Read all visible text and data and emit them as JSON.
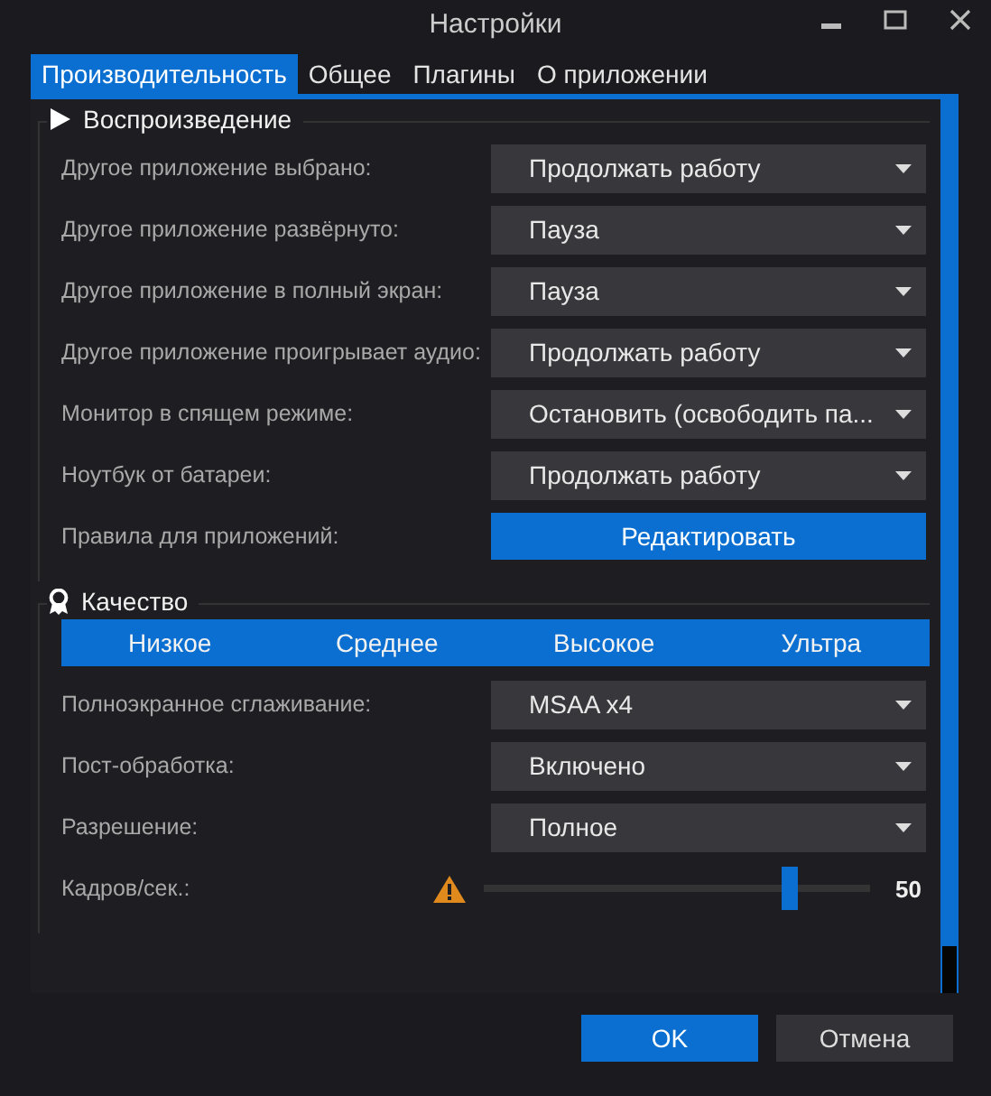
{
  "window": {
    "title": "Настройки"
  },
  "tabs": [
    {
      "label": "Производительность",
      "selected": true
    },
    {
      "label": "Общее",
      "selected": false
    },
    {
      "label": "Плагины",
      "selected": false
    },
    {
      "label": "О приложении",
      "selected": false
    }
  ],
  "sections": [
    {
      "title": "Воспроизведение",
      "rows": [
        {
          "kind": "dropdown",
          "label": "Другое приложение выбрано:",
          "value": "Продолжать работу"
        },
        {
          "kind": "dropdown",
          "label": "Другое приложение развёрнуто:",
          "value": "Пауза"
        },
        {
          "kind": "dropdown",
          "label": "Другое приложение в полный экран:",
          "value": "Пауза"
        },
        {
          "kind": "dropdown",
          "label": "Другое приложение проигрывает аудио:",
          "value": "Продолжать работу"
        },
        {
          "kind": "dropdown",
          "label": "Монитор в спящем режиме:",
          "value": "Остановить (освободить па..."
        },
        {
          "kind": "dropdown",
          "label": "Ноутбук от батареи:",
          "value": "Продолжать работу"
        },
        {
          "kind": "button",
          "label": "Правила для приложений:",
          "value": "Редактировать"
        }
      ]
    },
    {
      "title": "Качество",
      "presets": [
        {
          "label": "Низкое",
          "selected": false
        },
        {
          "label": "Среднее",
          "selected": false
        },
        {
          "label": "Высокое",
          "selected": false
        },
        {
          "label": "Ультра",
          "selected": false
        }
      ],
      "rows": [
        {
          "kind": "dropdown",
          "label": "Полноэкранное сглаживание:",
          "value": "MSAA x4"
        },
        {
          "kind": "dropdown",
          "label": "Пост-обработка:",
          "value": "Включено"
        },
        {
          "kind": "dropdown",
          "label": "Разрешение:",
          "value": "Полное"
        },
        {
          "kind": "slider",
          "label": "Кадров/сек.:",
          "warning": true,
          "level": 0.79,
          "value": "50"
        }
      ]
    }
  ],
  "buttons": [
    {
      "label": "OK",
      "kind": "primary"
    },
    {
      "label": "Отмена",
      "kind": "secondary"
    }
  ]
}
